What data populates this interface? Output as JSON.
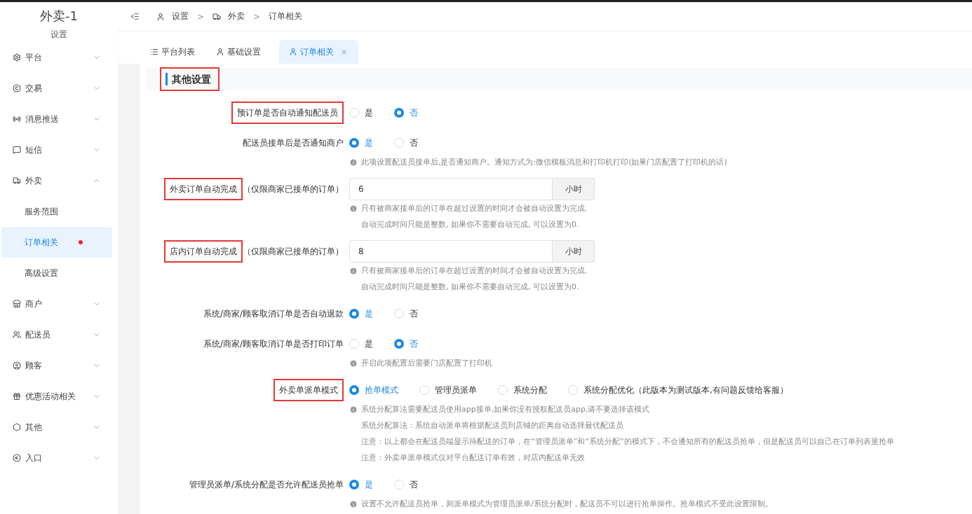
{
  "sidebar": {
    "title": "外卖-1",
    "subtitle": "设置",
    "items": [
      {
        "label": "平台",
        "expanded": false
      },
      {
        "label": "交易",
        "expanded": false
      },
      {
        "label": "消息推送",
        "expanded": false
      },
      {
        "label": "短信",
        "expanded": false
      },
      {
        "label": "外卖",
        "expanded": true,
        "children": [
          {
            "label": "服务范围",
            "selected": false,
            "dot": false
          },
          {
            "label": "订单相关",
            "selected": true,
            "dot": true
          },
          {
            "label": "高级设置",
            "selected": false,
            "dot": false
          }
        ]
      },
      {
        "label": "商户",
        "expanded": false
      },
      {
        "label": "配送员",
        "expanded": false
      },
      {
        "label": "顾客",
        "expanded": false
      },
      {
        "label": "优惠活动相关",
        "expanded": false
      },
      {
        "label": "其他",
        "expanded": false
      },
      {
        "label": "入口",
        "expanded": false
      }
    ]
  },
  "breadcrumb": [
    {
      "label": "设置"
    },
    {
      "separator": ">",
      "label": "外卖"
    },
    {
      "separator": ">",
      "label": "订单相关"
    }
  ],
  "tabs": [
    {
      "label": "平台列表",
      "selected": false
    },
    {
      "label": "基础设置",
      "selected": false
    },
    {
      "label": "订单相关",
      "selected": true,
      "close": "×"
    }
  ],
  "section": {
    "title": "其他设置",
    "highlighted": true
  },
  "fields": [
    {
      "kind": "radio",
      "label": "预订单是否自动通知配送员",
      "highlighted": true,
      "options": [
        {
          "label": "是",
          "selected": false
        },
        {
          "label": "否",
          "selected": true
        }
      ]
    },
    {
      "kind": "radio",
      "label": "配送员接单后是否通知商户",
      "highlighted": false,
      "options": [
        {
          "label": "是",
          "selected": true
        },
        {
          "label": "否",
          "selected": false
        }
      ],
      "help": [
        "此项设置配送员接单后,是否通知商户。通知方式为:微信模板消息和打印机打印(如果门店配置了打印机的话)"
      ]
    },
    {
      "kind": "number",
      "label": "外卖订单自动完成",
      "note": "（仅限商家已接单的订单）",
      "highlighted": true,
      "value": "6",
      "unit": "小时",
      "help": [
        "只有被商家接单后的订单在超过设置的时间才会被自动设置为完成.",
        "自动完成时间只能是整数, 如果你不需要自动完成, 可以设置为0."
      ]
    },
    {
      "kind": "number",
      "label": "店内订单自动完成",
      "note": "（仅限商家已接单的订单）",
      "highlighted": true,
      "value": "8",
      "unit": "小时",
      "help": [
        "只有被商家接单后的订单在超过设置的时间才会被自动设置为完成.",
        "自动完成时间只能是整数, 如果你不需要自动完成, 可以设置为0."
      ]
    },
    {
      "kind": "radio",
      "label": "系统/商家/顾客取消订单是否自动退款",
      "highlighted": false,
      "options": [
        {
          "label": "是",
          "selected": true
        },
        {
          "label": "否",
          "selected": false
        }
      ]
    },
    {
      "kind": "radio",
      "label": "系统/商家/顾客取消订单是否打印订单",
      "highlighted": false,
      "options": [
        {
          "label": "是",
          "selected": false
        },
        {
          "label": "否",
          "selected": true
        }
      ],
      "help": [
        "开启此项配置后需要门店配置了打印机"
      ]
    },
    {
      "kind": "radio",
      "label": "外卖单派单模式",
      "highlighted": true,
      "options": [
        {
          "label": "抢单模式",
          "selected": true
        },
        {
          "label": "管理员派单",
          "selected": false
        },
        {
          "label": "系统分配",
          "selected": false
        },
        {
          "label": "系统分配优化（此版本为测试版本,有问题反馈给客服）",
          "selected": false
        }
      ],
      "help": [
        "系统分配算法需要配送员使用app接单,如果你没有授权配送员app,请不要选择该模式",
        "系统分配算法：系统自动派单将根据配送员到店铺的距离自动选择最优配送员",
        "注意：以上都会在配送员端显示待配送的订单，在“管理员派单”和“系统分配”的模式下，不会通知所有的配送员抢单，但是配送员可以自己在订单列表里抢单",
        "注意：外卖单派单模式仅对平台配送订单有效，对店内配送单无效"
      ]
    },
    {
      "kind": "radio",
      "label": "管理员派单/系统分配是否允许配送员抢单",
      "highlighted": false,
      "options": [
        {
          "label": "是",
          "selected": true
        },
        {
          "label": "否",
          "selected": false
        }
      ],
      "help": [
        "设置不允许配送员抢单，则派单模式为管理员派单/系统分配时，配送员不可以进行抢单操作。抢单模式不受此设置限制。"
      ]
    }
  ]
}
